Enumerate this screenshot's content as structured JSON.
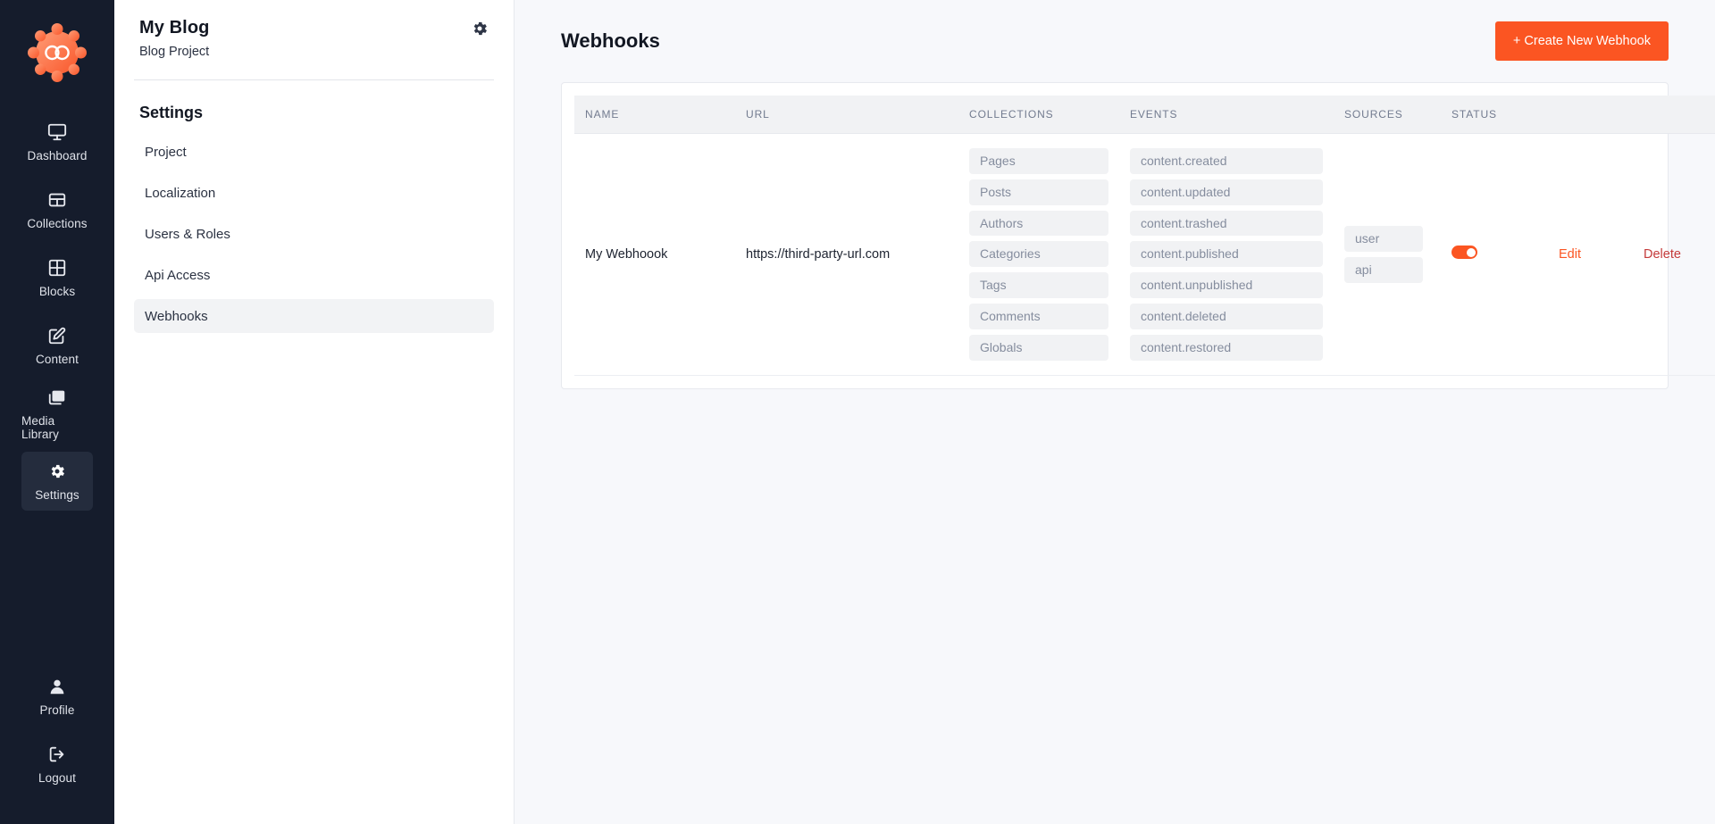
{
  "rail": {
    "logo_icon": "gear-infinity-logo",
    "items": [
      {
        "label": "Dashboard",
        "icon": "monitor-icon",
        "active": false
      },
      {
        "label": "Collections",
        "icon": "table-icon",
        "active": false
      },
      {
        "label": "Blocks",
        "icon": "grid-icon",
        "active": false
      },
      {
        "label": "Content",
        "icon": "edit-square-icon",
        "active": false
      },
      {
        "label": "Media Library",
        "icon": "image-stack-icon",
        "active": false
      },
      {
        "label": "Settings",
        "icon": "gear-icon",
        "active": true
      }
    ],
    "bottom_items": [
      {
        "label": "Profile",
        "icon": "user-icon",
        "active": false
      },
      {
        "label": "Logout",
        "icon": "logout-icon",
        "active": false
      }
    ]
  },
  "panel": {
    "project_title": "My Blog",
    "project_subtitle": "Blog Project",
    "gear_icon": "gear-icon",
    "section_title": "Settings",
    "items": [
      {
        "label": "Project",
        "active": false
      },
      {
        "label": "Localization",
        "active": false
      },
      {
        "label": "Users & Roles",
        "active": false
      },
      {
        "label": "Api Access",
        "active": false
      },
      {
        "label": "Webhooks",
        "active": true
      }
    ]
  },
  "main": {
    "title": "Webhooks",
    "create_button": "+ Create New Webhook",
    "table": {
      "headers": {
        "name": "NAME",
        "url": "URL",
        "collections": "COLLECTIONS",
        "events": "EVENTS",
        "sources": "SOURCES",
        "status": "STATUS"
      },
      "rows": [
        {
          "name": "My Webhoook",
          "url": "https://third-party-url.com",
          "collections": [
            "Pages",
            "Posts",
            "Authors",
            "Categories",
            "Tags",
            "Comments",
            "Globals"
          ],
          "events": [
            "content.created",
            "content.updated",
            "content.trashed",
            "content.published",
            "content.unpublished",
            "content.deleted",
            "content.restored"
          ],
          "sources": [
            "user",
            "api"
          ],
          "status_enabled": true,
          "edit_label": "Edit",
          "delete_label": "Delete"
        }
      ]
    }
  },
  "colors": {
    "accent": "#fb5522",
    "delete": "#c43a3a",
    "rail_bg": "#151c2c",
    "rail_active": "#242c3d",
    "page_bg": "#f7f8fb",
    "tag_bg": "#f1f2f4"
  }
}
